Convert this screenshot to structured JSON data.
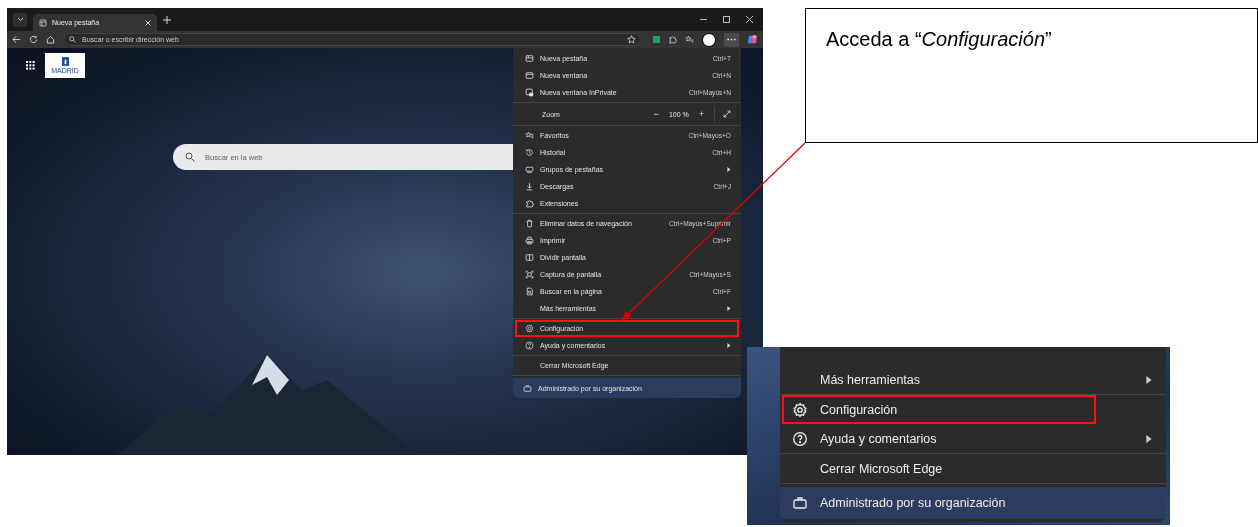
{
  "browser": {
    "tabs": [
      {
        "label": "Nueva pestaña",
        "selected": true
      }
    ],
    "address_bar": {
      "placeholder": "Buscar o escribir dirección web"
    },
    "logo_text": "MADRID",
    "search": {
      "placeholder": "Buscar en la web"
    },
    "menu": {
      "sections": [
        [
          {
            "kind": "item",
            "label": "Nueva pestaña",
            "shortcut": "Ctrl+T",
            "submenu": false,
            "highlighted": false
          },
          {
            "kind": "item",
            "label": "Nueva ventana",
            "shortcut": "Ctrl+N",
            "submenu": false,
            "highlighted": false
          },
          {
            "kind": "item",
            "label": "Nueva ventana InPrivate",
            "shortcut": "Ctrl+Mayús+N",
            "submenu": false,
            "highlighted": false
          }
        ],
        [
          {
            "kind": "zoom",
            "label": "Zoom",
            "minus": "−",
            "value": "100 %",
            "plus": "+"
          }
        ],
        [
          {
            "kind": "item",
            "label": "Favoritos",
            "shortcut": "Ctrl+Mayús+O",
            "submenu": false,
            "highlighted": false
          },
          {
            "kind": "item",
            "label": "Historial",
            "shortcut": "Ctrl+H",
            "submenu": false,
            "highlighted": false
          },
          {
            "kind": "item",
            "label": "Grupos de pestañas",
            "submenu": true,
            "highlighted": false
          },
          {
            "kind": "item",
            "label": "Descargas",
            "shortcut": "Ctrl+J",
            "submenu": false,
            "highlighted": false
          },
          {
            "kind": "item",
            "label": "Extensiones",
            "submenu": false,
            "highlighted": false
          }
        ],
        [
          {
            "kind": "item",
            "label": "Eliminar datos de navegación",
            "shortcut": "Ctrl+Mayús+Suprimir",
            "submenu": false,
            "highlighted": false
          },
          {
            "kind": "item",
            "label": "Imprimir",
            "shortcut": "Ctrl+P",
            "submenu": false,
            "highlighted": false
          },
          {
            "kind": "item",
            "label": "Dividir pantalla",
            "submenu": false,
            "highlighted": false
          },
          {
            "kind": "item",
            "label": "Captura de pantalla",
            "shortcut": "Ctrl+Mayús+S",
            "submenu": false,
            "highlighted": false
          },
          {
            "kind": "item",
            "label": "Buscar en la página",
            "shortcut": "Ctrl+F",
            "submenu": false,
            "highlighted": false
          },
          {
            "kind": "item",
            "label": "Más herramientas",
            "submenu": true,
            "highlighted": false
          }
        ],
        [
          {
            "kind": "item",
            "label": "Configuración",
            "submenu": false,
            "highlighted": true
          },
          {
            "kind": "item",
            "label": "Ayuda y comentarios",
            "submenu": true,
            "highlighted": false
          }
        ],
        [
          {
            "kind": "item",
            "label": "Cerrar Microsoft Edge",
            "submenu": false,
            "highlighted": false
          }
        ],
        [
          {
            "kind": "footer",
            "label": "Administrado por su organización"
          }
        ]
      ]
    }
  },
  "callout": {
    "text": "Acceda a “*Configuración*”"
  },
  "inset": {
    "sections": [
      [
        {
          "kind": "item",
          "label": "Más herramientas",
          "submenu": true,
          "highlighted": false
        }
      ],
      [
        {
          "kind": "item",
          "label": "Configuración",
          "submenu": false,
          "highlighted": true
        },
        {
          "kind": "item",
          "label": "Ayuda y comentarios",
          "submenu": true,
          "highlighted": false
        }
      ],
      [
        {
          "kind": "item",
          "label": "Cerrar Microsoft Edge",
          "submenu": false,
          "highlighted": false
        }
      ],
      [
        {
          "kind": "footer",
          "label": "Administrado por su organización"
        }
      ]
    ]
  }
}
